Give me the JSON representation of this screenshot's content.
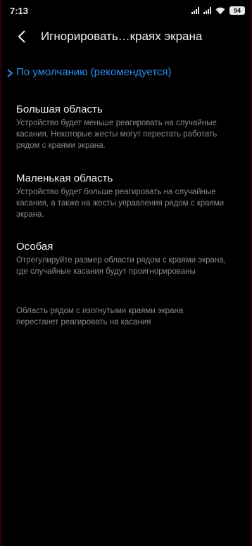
{
  "status_bar": {
    "time": "7:13",
    "battery": "94",
    "icons": [
      "signal-icon",
      "wifi-icon",
      "battery-icon"
    ]
  },
  "header": {
    "title": "Игнорировать…краях экрана"
  },
  "options": [
    {
      "title": "По умолчанию (рекомендуется)",
      "description": "",
      "selected": true
    },
    {
      "title": "Большая область",
      "description": "Устройство будет меньше реагировать на случайные касания. Некоторые жесты могут перестать работать рядом с краями экрана.",
      "selected": false
    },
    {
      "title": "Маленькая область",
      "description": "Устройство будет больше реагировать на случайные касания, а также на жесты управления рядом с краями экрана.",
      "selected": false
    },
    {
      "title": "Особая",
      "description": "Отрегулируйте размер области рядом с краями экрана, где случайные касания будут проигнорированы",
      "selected": false
    }
  ],
  "footer_note": "Область рядом с изогнутыми краями экрана перестанет реагировать на касания",
  "colors": {
    "accent": "#2d8ef2",
    "background": "#000000",
    "secondary_text": "#8a8a8a"
  }
}
